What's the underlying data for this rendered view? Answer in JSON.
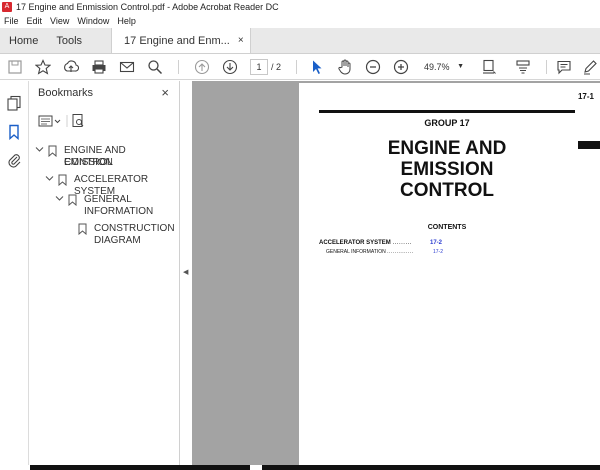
{
  "window": {
    "title": "17 Engine and Enmission Control.pdf - Adobe Acrobat Reader DC"
  },
  "menu": {
    "items": [
      "File",
      "Edit",
      "View",
      "Window",
      "Help"
    ]
  },
  "tabs": {
    "home": "Home",
    "tools": "Tools",
    "document": "17 Engine and Enm...",
    "close": "×"
  },
  "toolbar": {
    "page_current": "1",
    "page_total": "/ 2",
    "zoom": "49.7%",
    "icons": [
      "save-icon",
      "bookmark-star-icon",
      "upload-icon",
      "print-icon",
      "email-icon",
      "search-icon",
      "page-up-icon",
      "page-down-icon",
      "select-cursor-icon",
      "hand-icon",
      "zoom-out-icon",
      "zoom-in-icon",
      "fit-page-icon",
      "scroll-mode-icon",
      "comment-icon",
      "pen-icon"
    ]
  },
  "sidebar": {
    "title": "Bookmarks",
    "close": "×",
    "items": [
      {
        "line1": "ENGINE AND EMISSION",
        "line2": "CONTROL"
      },
      {
        "line1": "ACCELERATOR SYSTEM",
        "line2": ""
      },
      {
        "line1": "GENERAL",
        "line2": "INFORMATION"
      },
      {
        "line1": "CONSTRUCTION",
        "line2": "DIAGRAM"
      }
    ]
  },
  "document": {
    "page_number": "17-1",
    "group": "GROUP 17",
    "title_line1": "ENGINE AND",
    "title_line2": "EMISSION",
    "title_line3": "CONTROL",
    "contents_heading": "CONTENTS",
    "toc": [
      {
        "label": "ACCELERATOR SYSTEM",
        "dots": ".........",
        "page": "17-2"
      },
      {
        "label": "GENERAL INFORMATION",
        "dots": "..............",
        "page": "17-2"
      }
    ]
  },
  "colors": {
    "accent": "#2a3bd0",
    "doc_background": "#a3a3a3",
    "pdf_icon": "#d7282f"
  }
}
